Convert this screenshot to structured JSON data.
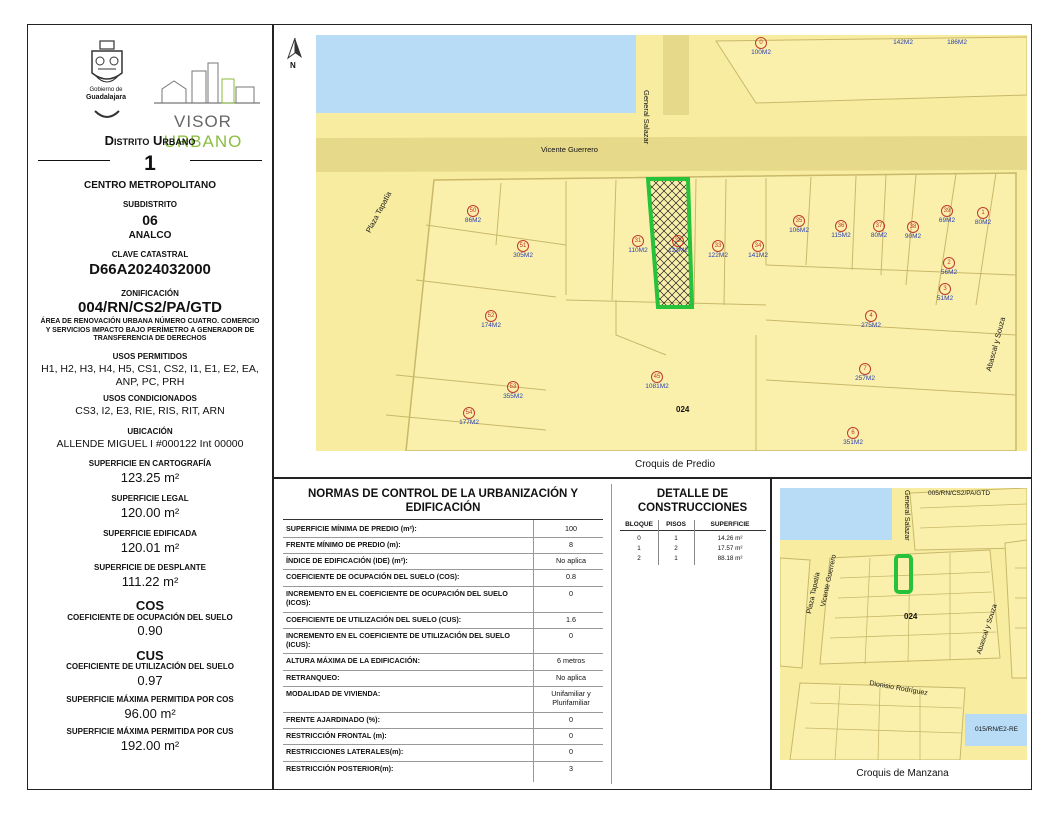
{
  "logos": {
    "guadalajara_text_1": "Gobierno de",
    "guadalajara_text_2": "Guadalajara",
    "visor_word_1": "VISOR",
    "visor_word_2": "URBANO"
  },
  "left": {
    "distrito_label": "Distrito Urbano",
    "distrito_num": "1",
    "distrito_name": "CENTRO METROPOLITANO",
    "subdistrito_label": "SUBDISTRITO",
    "subdistrito_num": "06",
    "subdistrito_name": "ANALCO",
    "clave_label": "CLAVE CATASTRAL",
    "clave_value": "D66A2024032000",
    "zonif_label": "ZONIFICACIÓN",
    "zonif_value": "004/RN/CS2/PA/GTD",
    "zonif_desc": "ÁREA DE RENOVACIÓN URBANA NÚMERO CUATRO. COMERCIO Y SERVICIOS IMPACTO BAJO PERÍMETRO A GENERADOR DE TRANSFERENCIA DE DERECHOS",
    "usos_perm_label": "USOS PERMITIDOS",
    "usos_perm_value": "H1, H2, H3, H4, H5, CS1, CS2, I1, E1, E2, EA, ANP, PC, PRH",
    "usos_cond_label": "USOS CONDICIONADOS",
    "usos_cond_value": "CS3, I2, E3, RIE, RIS, RIT, ARN",
    "ubic_label": "UBICACIÓN",
    "ubic_value": "ALLENDE MIGUEL I #000122 Int 00000",
    "sup_cart_label": "SUPERFICIE EN CARTOGRAFÍA",
    "sup_cart_value": "123.25 m²",
    "sup_legal_label": "SUPERFICIE LEGAL",
    "sup_legal_value": "120.00 m²",
    "sup_edif_label": "SUPERFICIE EDIFICADA",
    "sup_edif_value": "120.01 m²",
    "sup_despl_label": "SUPERFICIE DE DESPLANTE",
    "sup_despl_value": "111.22 m²",
    "cos_title": "COS",
    "cos_label": "COEFICIENTE DE OCUPACIÓN DEL SUELO",
    "cos_value": "0.90",
    "cus_title": "CUS",
    "cus_label": "COEFICIENTE DE UTILIZACIÓN DEL SUELO",
    "cus_value": "0.97",
    "sup_max_cos_label": "SUPERFICIE MÁXIMA PERMITIDA POR COS",
    "sup_max_cos_value": "96.00 m²",
    "sup_max_cus_label": "SUPERFICIE MÁXIMA PERMITIDA POR CUS",
    "sup_max_cus_value": "192.00 m²"
  },
  "predio_map": {
    "caption": "Croquis de Predio",
    "north": "N",
    "streets": [
      "General Salazar",
      "Vicente Guerrero",
      "Plaza Tapatía",
      "Abascal y Souza"
    ],
    "block": "024",
    "lots": [
      {
        "num": "0",
        "area": "100M2"
      },
      {
        "num": "",
        "area": "142M2"
      },
      {
        "num": "",
        "area": "186M2"
      },
      {
        "num": "50",
        "area": "86M2"
      },
      {
        "num": "51",
        "area": "305M2"
      },
      {
        "num": "31",
        "area": "110M2"
      },
      {
        "num": "32",
        "area": "123M2"
      },
      {
        "num": "33",
        "area": "122M2"
      },
      {
        "num": "34",
        "area": "141M2"
      },
      {
        "num": "35",
        "area": "106M2"
      },
      {
        "num": "36",
        "area": "115M2"
      },
      {
        "num": "37",
        "area": "80M2"
      },
      {
        "num": "38",
        "area": "90M2"
      },
      {
        "num": "39",
        "area": "69M2"
      },
      {
        "num": "1",
        "area": "80M2"
      },
      {
        "num": "2",
        "area": "56M2"
      },
      {
        "num": "3",
        "area": "51M2"
      },
      {
        "num": "52",
        "area": "174M2"
      },
      {
        "num": "4",
        "area": "275M2"
      },
      {
        "num": "45",
        "area": "1081M2"
      },
      {
        "num": "7",
        "area": "257M2"
      },
      {
        "num": "53",
        "area": "355M2"
      },
      {
        "num": "54",
        "area": "177M2"
      },
      {
        "num": "6",
        "area": "351M2"
      }
    ]
  },
  "manzana_map": {
    "caption": "Croquis de Manzana",
    "zone_top": "005/RN/CS2/PA/GTD",
    "zone_bottom": "015/RN/E2-RE",
    "block": "024",
    "streets": [
      "General Salazar",
      "Vicente Guerrero",
      "Plaza Tapatía",
      "Abascal y Souza",
      "Dionisio Rodríguez"
    ]
  },
  "normas": {
    "title": "NORMAS DE CONTROL DE LA URBANIZACIÓN Y EDIFICACIÓN",
    "rows": [
      {
        "label": "SUPERFICIE MÍNIMA DE PREDIO (m²):",
        "value": "100"
      },
      {
        "label": "FRENTE MÍNIMO DE PREDIO (m):",
        "value": "8"
      },
      {
        "label": "ÍNDICE DE EDIFICACIÓN (IDE) (m²):",
        "value": "No aplica"
      },
      {
        "label": "COEFICIENTE DE OCUPACIÓN DEL SUELO (COS):",
        "value": "0.8"
      },
      {
        "label": "INCREMENTO EN EL COEFICIENTE DE OCUPACIÓN DEL SUELO (ICOS):",
        "value": "0"
      },
      {
        "label": "COEFICIENTE DE UTILIZACIÓN DEL SUELO (CUS):",
        "value": "1.6"
      },
      {
        "label": "INCREMENTO EN EL COEFICIENTE DE UTILIZACIÓN DEL SUELO (ICUS):",
        "value": "0"
      },
      {
        "label": "ALTURA MÁXIMA DE LA EDIFICACIÓN:",
        "value": "6 metros"
      },
      {
        "label": "RETRANQUEO:",
        "value": "No aplica"
      },
      {
        "label": "MODALIDAD DE VIVIENDA:",
        "value": "Unifamiliar y Plurifamiliar"
      },
      {
        "label": "FRENTE AJARDINADO (%):",
        "value": "0"
      },
      {
        "label": "RESTRICCIÓN FRONTAL (m):",
        "value": "0"
      },
      {
        "label": "RESTRICCIONES LATERALES(m):",
        "value": "0"
      },
      {
        "label": "RESTRICCIÓN POSTERIOR(m):",
        "value": "3"
      }
    ]
  },
  "detalle": {
    "title": "DETALLE DE CONSTRUCCIONES",
    "headers": [
      "BLOQUE",
      "PISOS",
      "SUPERFICIE"
    ],
    "rows": [
      [
        "0",
        "1",
        "14.26 m²"
      ],
      [
        "1",
        "2",
        "17.57 m²"
      ],
      [
        "2",
        "1",
        "88.18 m²"
      ]
    ]
  },
  "colors": {
    "map_bg": "#f7ec9f",
    "water": "#b8dbf6",
    "selected": "#25c23a",
    "lot_line": "#c9b86a",
    "lot_num": "#c0392b",
    "lot_area": "#2a3fb0",
    "visor_green": "#8bbd3f"
  }
}
